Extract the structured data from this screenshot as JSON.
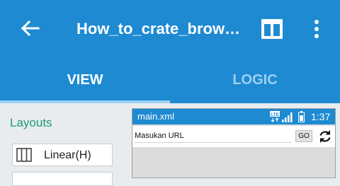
{
  "appbar": {
    "title": "How_to_crate_brow…",
    "icons": {
      "back": "arrow-back-icon",
      "layout": "layout-icon",
      "more": "more-vert-icon"
    }
  },
  "tabs": [
    {
      "label": "VIEW",
      "active": true
    },
    {
      "label": "LOGIC",
      "active": false
    }
  ],
  "palette": {
    "title": "Layouts",
    "items": [
      {
        "label": "Linear(H)",
        "icon": "linear-horizontal-icon"
      }
    ]
  },
  "preview": {
    "file_name": "main.xml",
    "time": "1:37",
    "status_icons": [
      "lte-icon",
      "signal-icon",
      "battery-icon"
    ],
    "url_placeholder": "Masukan URL",
    "go_label": "GO",
    "refresh_icon": "refresh-icon"
  },
  "colors": {
    "primary": "#1e8ad2",
    "tab_inactive": "#9fd0f2",
    "palette_title": "#1a9a78",
    "background": "#e9ecef"
  }
}
